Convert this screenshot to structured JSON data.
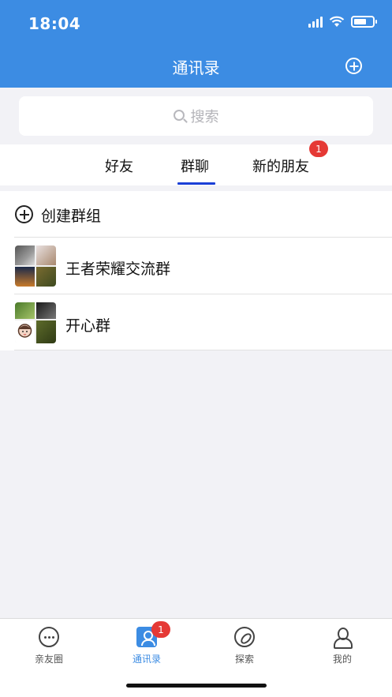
{
  "status_bar": {
    "time": "18:04"
  },
  "nav": {
    "title": "通讯录"
  },
  "search": {
    "placeholder": "搜索"
  },
  "tabs": [
    {
      "label": "好友"
    },
    {
      "label": "群聊"
    },
    {
      "label": "新的朋友",
      "badge": "1"
    }
  ],
  "list": {
    "create_label": "创建群组",
    "groups": [
      {
        "name": "王者荣耀交流群"
      },
      {
        "name": "开心群"
      }
    ]
  },
  "tabbar": {
    "items": [
      {
        "label": "亲友圈",
        "icon": "chat-bubble-icon"
      },
      {
        "label": "通讯录",
        "icon": "contacts-icon",
        "badge": "1"
      },
      {
        "label": "探索",
        "icon": "compass-icon"
      },
      {
        "label": "我的",
        "icon": "person-icon"
      }
    ]
  },
  "colors": {
    "header": "#3c8ce3",
    "active_tab_underline": "#1a3fd6",
    "badge": "#e53935",
    "tabbar_active": "#3c8ce3"
  }
}
